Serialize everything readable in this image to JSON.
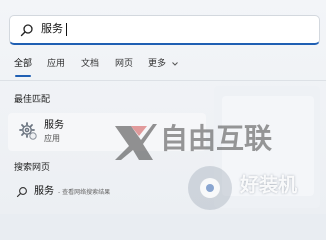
{
  "search": {
    "query": "服务"
  },
  "tabs": [
    {
      "label": "全部",
      "active": true
    },
    {
      "label": "应用"
    },
    {
      "label": "文档"
    },
    {
      "label": "网页"
    },
    {
      "label": "更多"
    }
  ],
  "best_match": {
    "section_title": "最佳匹配",
    "name": "服务",
    "subtitle": "应用",
    "icon": "gear-icon"
  },
  "web": {
    "section_title": "搜索网页",
    "query": "服务",
    "subtitle": "- 查看网络搜索结果"
  },
  "watermarks": {
    "primary": "自由互联",
    "secondary": "好装机"
  },
  "colors": {
    "accent": "#1f5fb3"
  }
}
